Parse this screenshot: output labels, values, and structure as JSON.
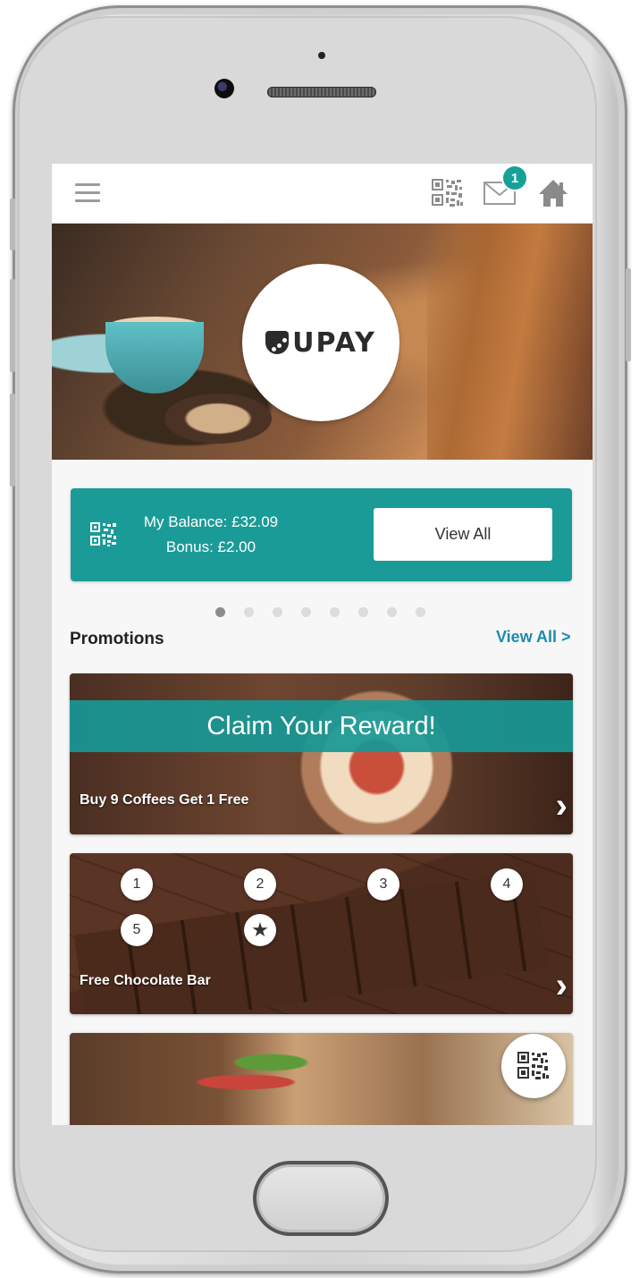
{
  "app": {
    "logo_text": "UPAY",
    "notification_count": "1"
  },
  "balance": {
    "balance_label": "My Balance: £32.09",
    "bonus_label": "Bonus: £2.00",
    "view_all_button": "View All"
  },
  "carousel": {
    "dot_count": 8,
    "active_index": 0
  },
  "promotions": {
    "title": "Promotions",
    "view_all_link": "View All >",
    "cards": [
      {
        "banner": "Claim Your Reward!",
        "label": "Buy 9 Coffees Get 1 Free"
      },
      {
        "label": "Free Chocolate Bar",
        "stamps": [
          "1",
          "2",
          "3",
          "4",
          "5",
          "★"
        ]
      },
      {
        "label": ""
      }
    ]
  },
  "icons": {
    "menu": "hamburger-icon",
    "qr": "qr-code-icon",
    "mail": "mail-icon",
    "home": "home-icon",
    "chevron": "chevron-right-icon"
  },
  "colors": {
    "accent": "#1b9b97",
    "link": "#1b8bb0",
    "badge": "#16a09a"
  }
}
